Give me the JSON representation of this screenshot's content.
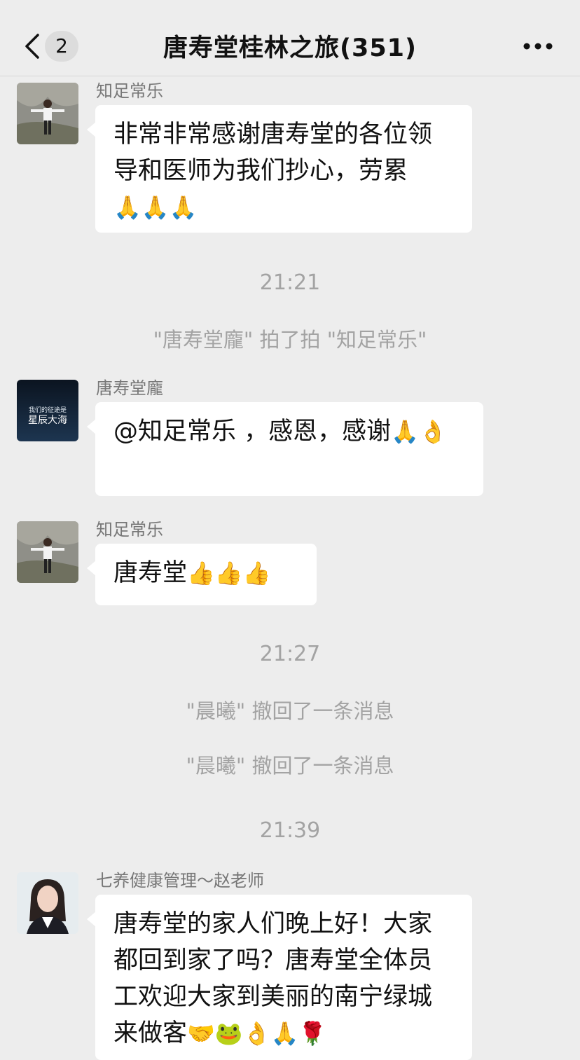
{
  "header": {
    "back_count": "2",
    "title": "唐寿堂桂林之旅(351)"
  },
  "messages": [
    {
      "sender": "知足常乐",
      "text": "非常非常感谢唐寿堂的各位领导和医师为我们抄心，劳累",
      "emojis": "🙏🙏🙏"
    },
    {
      "sender": "唐寿堂龐",
      "avatar_text": "我们的征途是星辰大海",
      "text": "@知足常乐 ，感恩，感谢",
      "emojis": "🙏👌"
    },
    {
      "sender": "知足常乐",
      "text": "唐寿堂",
      "emojis": "👍👍👍"
    },
    {
      "sender": "七养健康管理～赵老师",
      "text": "唐寿堂的家人们晚上好！大家都回到家了吗？唐寿堂全体员工欢迎大家到美丽的南宁绿城来做客",
      "emojis": "🤝🐸👌🙏🌹"
    }
  ],
  "system": {
    "time1": "21:21",
    "pat": "\"唐寿堂龐\" 拍了拍 \"知足常乐\"",
    "time2": "21:27",
    "recall1": "\"晨曦\" 撤回了一条消息",
    "recall2": "\"晨曦\" 撤回了一条消息",
    "time3": "21:39"
  },
  "colors": {
    "background": "#ededed",
    "bubble": "#ffffff",
    "system_text": "#a3a3a3"
  }
}
